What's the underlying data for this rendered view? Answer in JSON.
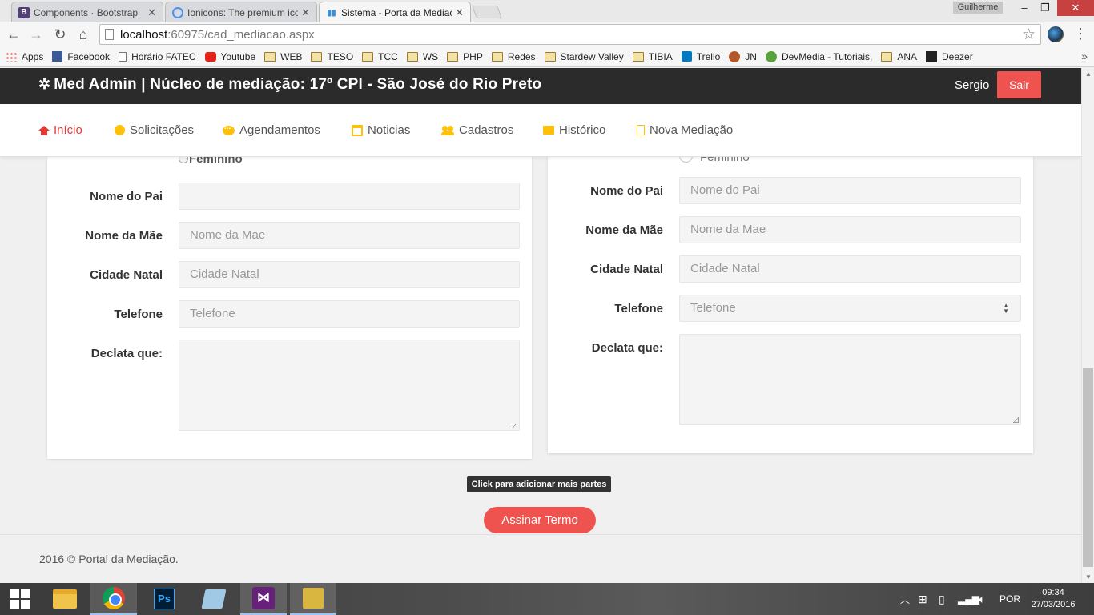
{
  "browser": {
    "tabs": [
      {
        "label": "Components · Bootstrap",
        "icon": "bootstrap-icon"
      },
      {
        "label": "Ionicons: The premium icon",
        "icon": "ionicons-icon"
      },
      {
        "label": "Sistema - Porta da Mediação",
        "icon": "chart-icon"
      }
    ],
    "profile": "Guilherme",
    "url_host": "localhost",
    "url_path": ":60975/cad_mediacao.aspx",
    "bookmarks": [
      {
        "label": "Apps",
        "icon": "apps-grid-icon"
      },
      {
        "label": "Facebook",
        "icon": "facebook-icon"
      },
      {
        "label": "Horário FATEC",
        "icon": "page-icon"
      },
      {
        "label": "Youtube",
        "icon": "youtube-icon"
      },
      {
        "label": "WEB",
        "icon": "folder-icon"
      },
      {
        "label": "TESO",
        "icon": "folder-icon"
      },
      {
        "label": "TCC",
        "icon": "folder-icon"
      },
      {
        "label": "WS",
        "icon": "folder-icon"
      },
      {
        "label": "PHP",
        "icon": "folder-icon"
      },
      {
        "label": "Redes",
        "icon": "folder-icon"
      },
      {
        "label": "Stardew Valley",
        "icon": "folder-icon"
      },
      {
        "label": "TIBIA",
        "icon": "folder-icon"
      },
      {
        "label": "Trello",
        "icon": "trello-icon"
      },
      {
        "label": "JN",
        "icon": "jn-icon"
      },
      {
        "label": "DevMedia - Tutoriais,",
        "icon": "devmedia-icon"
      },
      {
        "label": "ANA",
        "icon": "folder-icon"
      },
      {
        "label": "Deezer",
        "icon": "deezer-icon"
      }
    ]
  },
  "header": {
    "title": "Med Admin | Núcleo de mediação: 17º CPI - São José do Rio Preto",
    "user": "Sergio",
    "logout": "Sair"
  },
  "nav": [
    {
      "label": "Início",
      "icon": "home-icon",
      "active": true
    },
    {
      "label": "Solicitações",
      "icon": "circle-icon"
    },
    {
      "label": "Agendamentos",
      "icon": "chat-icon"
    },
    {
      "label": "Noticias",
      "icon": "calendar-icon"
    },
    {
      "label": "Cadastros",
      "icon": "users-icon"
    },
    {
      "label": "Histórico",
      "icon": "folder-icon"
    },
    {
      "label": "Nova Mediação",
      "icon": "file-icon"
    }
  ],
  "left_form": {
    "gender_option": "Feminino",
    "father_label": "Nome do Pai",
    "father_value": "",
    "mother_label": "Nome da Mãe",
    "mother_placeholder": "Nome da Mae",
    "city_label": "Cidade Natal",
    "city_placeholder": "Cidade Natal",
    "phone_label": "Telefone",
    "phone_placeholder": "Telefone",
    "declares_label": "Declata que:"
  },
  "right_form": {
    "gender_option": "Feminino",
    "father_label": "Nome do Pai",
    "father_placeholder": "Nome do Pai",
    "mother_label": "Nome da Mãe",
    "mother_placeholder": "Nome da Mae",
    "city_label": "Cidade Natal",
    "city_placeholder": "Cidade Natal",
    "phone_label": "Telefone",
    "phone_placeholder": "Telefone",
    "declares_label": "Declata que:"
  },
  "actions": {
    "tooltip": "Click para adicionar mais partes",
    "sign": "Assinar Termo"
  },
  "footer": {
    "text": "2016 © Portal da Mediação."
  },
  "taskbar": {
    "language": "POR",
    "time": "09:34",
    "date": "27/03/2016"
  },
  "colors": {
    "accent": "#ef5350",
    "header_bg": "#2b2b2b",
    "nav_icon": "#ffc107",
    "nav_active": "#e53935"
  }
}
